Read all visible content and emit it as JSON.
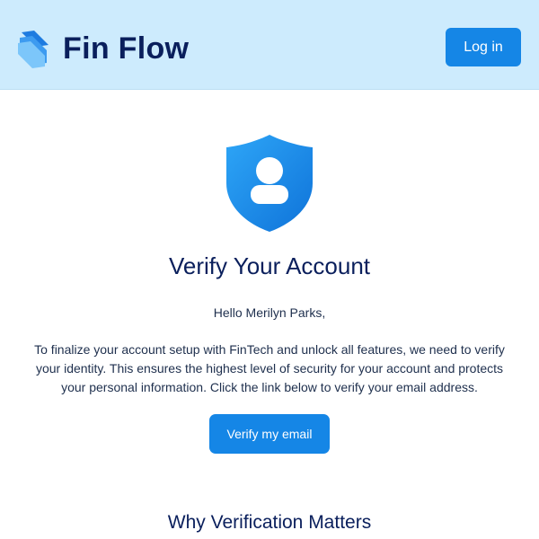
{
  "header": {
    "brand": "Fin Flow",
    "logo_icon": "stacked-cards-icon",
    "login_label": "Log in",
    "background_color": "#cdebfd"
  },
  "hero": {
    "icon": "shield-user-icon",
    "title": "Verify Your Account",
    "greeting": "Hello Merilyn Parks,",
    "body": "To finalize your account setup with FinTech and unlock all features, we need to verify your identity. This ensures the highest level of security for your account and protects your personal information. Click the link below to verify your email address.",
    "cta_label": "Verify my email"
  },
  "section": {
    "title": "Why Verification Matters"
  },
  "colors": {
    "accent": "#1586e6",
    "heading": "#0a1f5c",
    "text": "#1e2f4d"
  }
}
